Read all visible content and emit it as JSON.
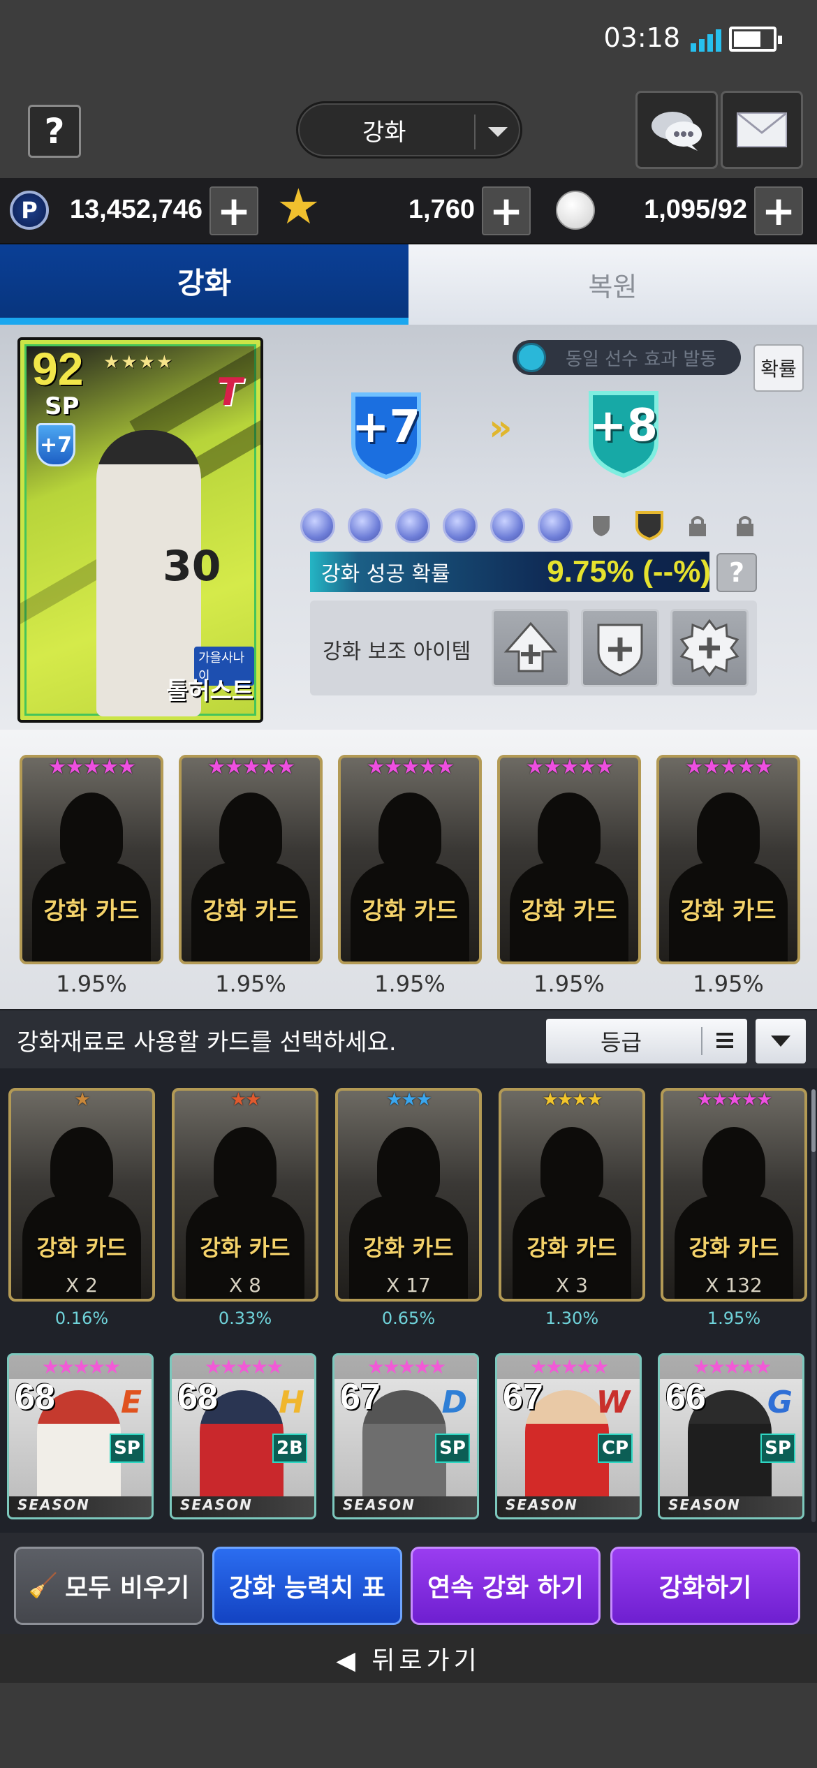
{
  "status": {
    "time": "03:18",
    "battery_level": 0.7
  },
  "header": {
    "help_label": "?",
    "mode_label": "강화"
  },
  "currency": {
    "points": "13,452,746",
    "stars": "1,760",
    "balls": "1,095/92"
  },
  "tabs": [
    {
      "label": "강화",
      "active": true
    },
    {
      "label": "복원",
      "active": false
    }
  ],
  "hero": {
    "rating": "92",
    "position": "SP",
    "level": "+7",
    "badge": "가을사나이",
    "name": "톨허스트",
    "stars": "★★★★",
    "number": "30"
  },
  "upgrade": {
    "same_player_effect": "동일 선수 효과 발동",
    "prob_button": "확률",
    "from_level": "+7",
    "to_level": "+8",
    "success_label": "강화 성공 확률",
    "success_value": "9.75% (--%)",
    "help": "?",
    "assist_label": "강화 보조 아이템"
  },
  "slots": {
    "items": [
      {
        "label": "강화 카드",
        "pct": "1.95%"
      },
      {
        "label": "강화 카드",
        "pct": "1.95%"
      },
      {
        "label": "강화 카드",
        "pct": "1.95%"
      },
      {
        "label": "강화 카드",
        "pct": "1.95%"
      },
      {
        "label": "강화 카드",
        "pct": "1.95%"
      }
    ]
  },
  "select_bar": {
    "prompt": "강화재료로 사용할 카드를 선택하세요.",
    "sort_label": "등급"
  },
  "materials": [
    {
      "label": "강화 카드",
      "count": "X 2",
      "pct": "0.16%",
      "stars": "★",
      "star_color": "#c9873a"
    },
    {
      "label": "강화 카드",
      "count": "X 8",
      "pct": "0.33%",
      "stars": "★★",
      "star_color": "#e05a2e"
    },
    {
      "label": "강화 카드",
      "count": "X 17",
      "pct": "0.65%",
      "stars": "★★★",
      "star_color": "#3aa6ee"
    },
    {
      "label": "강화 카드",
      "count": "X 3",
      "pct": "1.30%",
      "stars": "★★★★",
      "star_color": "#f2c52c"
    },
    {
      "label": "강화 카드",
      "count": "X 132",
      "pct": "1.95%",
      "stars": "★★★★★",
      "star_color": "#ee4fe0"
    }
  ],
  "players": [
    {
      "rating": "68",
      "position": "SP",
      "logo": "E",
      "logo_color": "#e0521e",
      "season": "SEASON"
    },
    {
      "rating": "68",
      "position": "2B",
      "logo": "H",
      "logo_color": "#f0b62d",
      "season": "SEASON"
    },
    {
      "rating": "67",
      "position": "SP",
      "logo": "D",
      "logo_color": "#2f7fd6",
      "season": "SEASON"
    },
    {
      "rating": "67",
      "position": "CP",
      "logo": "W",
      "logo_color": "#c9302c",
      "season": "SEASON"
    },
    {
      "rating": "66",
      "position": "SP",
      "logo": "G",
      "logo_color": "#2f6fd6",
      "season": "SEASON"
    }
  ],
  "player_stars": "★★★★★",
  "actions": {
    "clear": "모두 비우기",
    "table": "강화 능력치 표",
    "continuous": "연속 강화 하기",
    "upgrade": "강화하기"
  },
  "nav": {
    "back": "◀ 뒤로가기"
  }
}
